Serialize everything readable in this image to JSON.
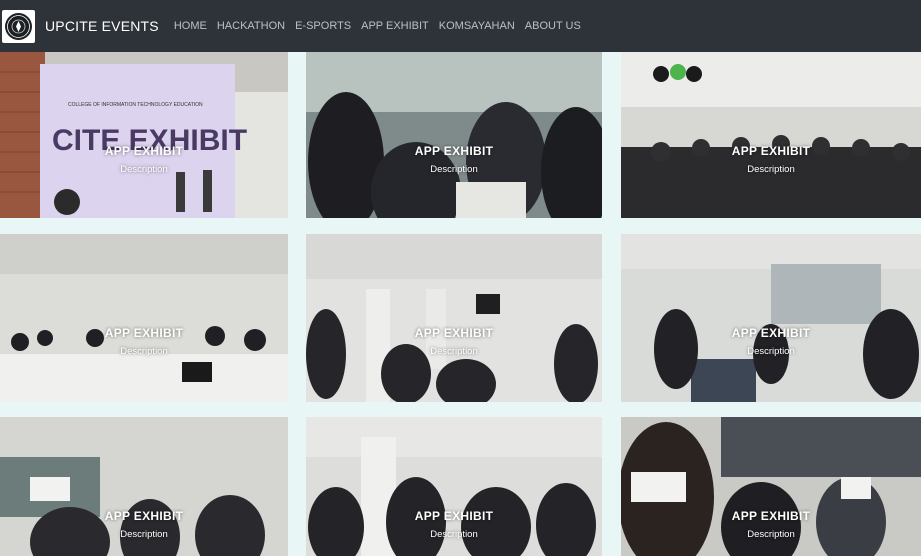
{
  "header": {
    "brand": "UPCITE EVENTS",
    "nav": [
      "HOME",
      "HACKATHON",
      "E-SPORTS",
      "APP EXHIBIT",
      "KOMSAYAHAN",
      "ABOUT US"
    ]
  },
  "gallery": {
    "cards": [
      {
        "title": "APP EXHIBIT",
        "description": "Description",
        "poster_title": "CITE EXHIBIT",
        "poster_sub": "COLLEGE OF INFORMATION TECHNOLOGY EDUCATION"
      },
      {
        "title": "APP EXHIBIT",
        "description": "Description"
      },
      {
        "title": "APP EXHIBIT",
        "description": "Description"
      },
      {
        "title": "APP EXHIBIT",
        "description": "Description"
      },
      {
        "title": "APP EXHIBIT",
        "description": "Description"
      },
      {
        "title": "APP EXHIBIT",
        "description": "Description"
      },
      {
        "title": "APP EXHIBIT",
        "description": "Description"
      },
      {
        "title": "APP EXHIBIT",
        "description": "Description"
      },
      {
        "title": "APP EXHIBIT",
        "description": "Description"
      }
    ]
  },
  "colors": {
    "navbar_bg": "#2e3339",
    "nav_link": "#b9c0c8",
    "page_bg": "#e8f6f6"
  }
}
